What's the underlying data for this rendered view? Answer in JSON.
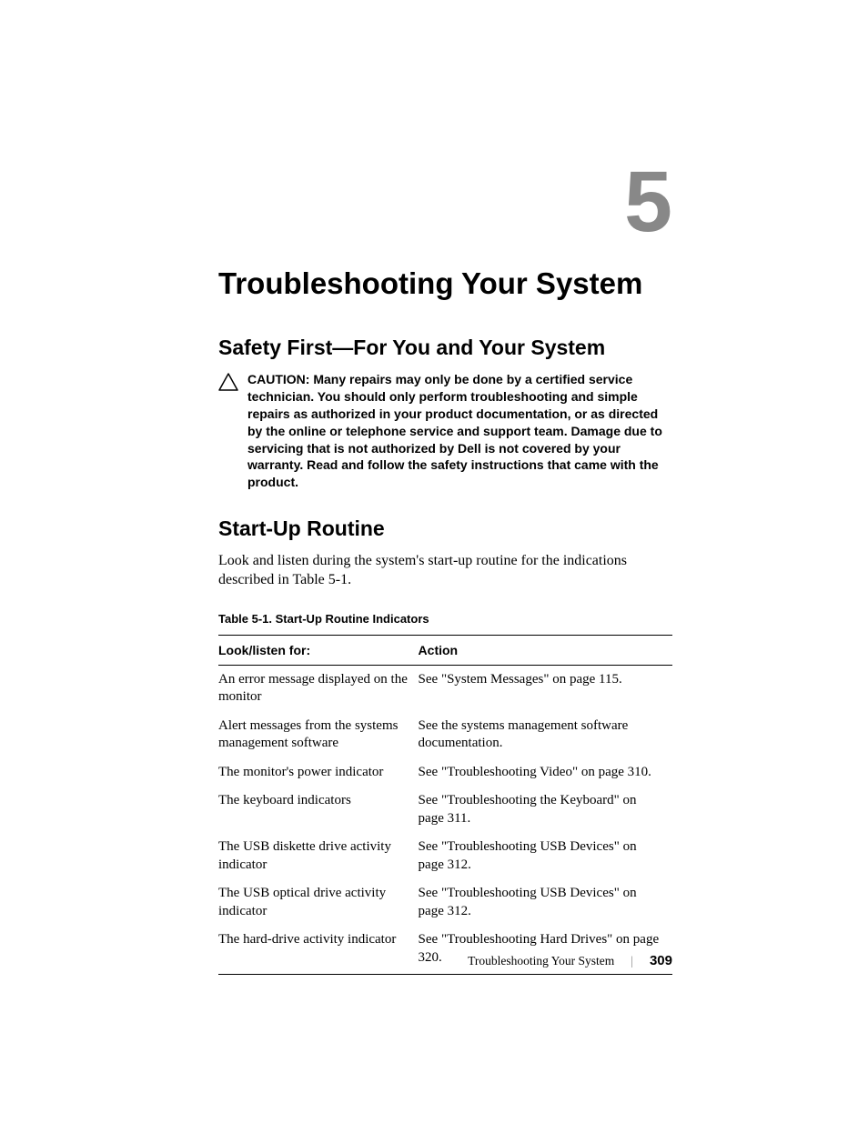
{
  "chapter": {
    "number": "5",
    "title": "Troubleshooting Your System"
  },
  "section1": {
    "title": "Safety First—For You and Your System",
    "caution_label": "CAUTION: ",
    "caution_text": "Many repairs may only be done by a certified service technician. You should only perform troubleshooting and simple repairs as authorized in your product documentation, or as directed by the online or telephone service and support team. Damage due to servicing that is not authorized by Dell is not covered by your warranty. Read and follow the safety instructions that came with the product."
  },
  "section2": {
    "title": "Start-Up Routine",
    "body": "Look and listen during the system's start-up routine for the indications described in Table 5-1."
  },
  "table": {
    "caption": "Table 5-1.    Start-Up Routine Indicators",
    "header": {
      "col1": "Look/listen for:",
      "col2": "Action"
    },
    "rows": [
      {
        "look": "An error message displayed on the monitor",
        "action": "See \"System Messages\" on page 115."
      },
      {
        "look": "Alert messages from the systems management software",
        "action": "See the systems management software documentation."
      },
      {
        "look": "The monitor's power indicator",
        "action": "See \"Troubleshooting Video\" on page 310."
      },
      {
        "look": "The keyboard indicators",
        "action": "See \"Troubleshooting the Keyboard\" on page 311."
      },
      {
        "look": "The USB diskette drive activity indicator",
        "action": "See \"Troubleshooting USB Devices\" on page 312."
      },
      {
        "look": "The USB optical drive activity indicator",
        "action": "See \"Troubleshooting USB Devices\" on page 312."
      },
      {
        "look": "The hard-drive activity indicator",
        "action": "See \"Troubleshooting Hard Drives\" on page 320."
      }
    ]
  },
  "footer": {
    "text": "Troubleshooting Your System",
    "divider": "|",
    "page": "309"
  }
}
